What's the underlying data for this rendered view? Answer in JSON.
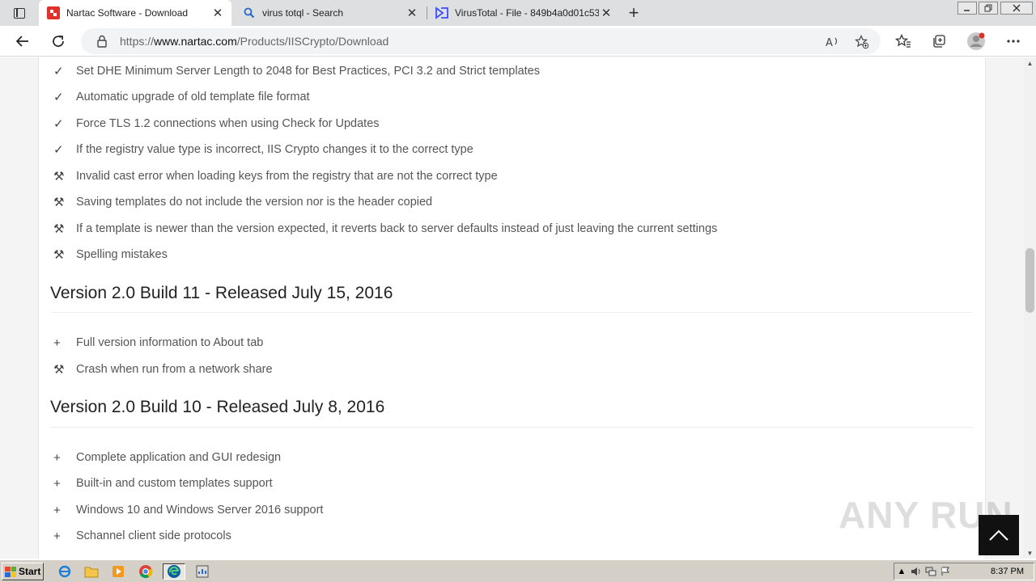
{
  "browser": {
    "tabs": [
      {
        "title": "Nartac Software - Download",
        "active": true,
        "favicon": "nartac-logo-icon"
      },
      {
        "title": "virus totql - Search",
        "active": false,
        "favicon": "search-icon"
      },
      {
        "title": "VirusTotal - File - 849b4a0d01c53",
        "active": false,
        "favicon": "virustotal-logo-icon"
      }
    ],
    "close_glyph": "✕",
    "new_tab_glyph": "+",
    "url_prefix": "https://",
    "url_host": "www.nartac.com",
    "url_path": "/Products/IISCrypto/Download"
  },
  "page": {
    "sections": [
      {
        "heading": "",
        "items": [
          {
            "type": "improvement",
            "text": "Set DHE Minimum Server Length to 2048 for Best Practices, PCI 3.2 and Strict templates"
          },
          {
            "type": "improvement",
            "text": "Automatic upgrade of old template file format"
          },
          {
            "type": "improvement",
            "text": "Force TLS 1.2 connections when using Check for Updates"
          },
          {
            "type": "improvement",
            "text": "If the registry value type is incorrect, IIS Crypto changes it to the correct type"
          },
          {
            "type": "fix",
            "text": "Invalid cast error when loading keys from the registry that are not the correct type"
          },
          {
            "type": "fix",
            "text": "Saving templates do not include the version nor is the header copied"
          },
          {
            "type": "fix",
            "text": "If a template is newer than the version expected, it reverts back to server defaults instead of just leaving the current settings"
          },
          {
            "type": "fix",
            "text": "Spelling mistakes"
          }
        ]
      },
      {
        "heading": "Version 2.0 Build 11 - Released July 15, 2016",
        "items": [
          {
            "type": "new",
            "text": "Full version information to About tab"
          },
          {
            "type": "fix",
            "text": "Crash when run from a network share"
          }
        ]
      },
      {
        "heading": "Version 2.0 Build 10 - Released July 8, 2016",
        "items": [
          {
            "type": "new",
            "text": "Complete application and GUI redesign"
          },
          {
            "type": "new",
            "text": "Built-in and custom templates support"
          },
          {
            "type": "new",
            "text": "Windows 10 and Windows Server 2016 support"
          },
          {
            "type": "new",
            "text": "Schannel client side protocols"
          }
        ]
      }
    ],
    "marks": {
      "improvement": "✓",
      "fix": "⚒",
      "new": "+"
    }
  },
  "watermark": "ANY RUN",
  "taskbar": {
    "start_label": "Start",
    "clock": "8:37 PM"
  },
  "colors": {
    "nartac_red": "#e0322b",
    "edge_blue": "#0c59a4",
    "virustotal_blue": "#394eff"
  }
}
